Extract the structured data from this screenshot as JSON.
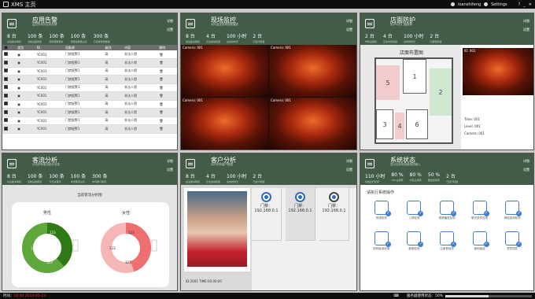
{
  "window": {
    "title": "XMS 主页",
    "user": "loanshifeng",
    "settings": "Settings"
  },
  "common": {
    "detail": "详细",
    "setup": "设置"
  },
  "alarm": {
    "title": "应用告警",
    "sub": "监控所有的应用告警",
    "stats": [
      {
        "v": "8 台",
        "l": "总设备关联机"
      },
      {
        "v": "100 条",
        "l": "当前设备告警"
      },
      {
        "v": "100 条",
        "l": "待处理告警条"
      },
      {
        "v": "100 条",
        "l": "告警总数量占比"
      },
      {
        "v": "300 条",
        "l": "已完成告警数量"
      }
    ],
    "cols": [
      "",
      "类型",
      "ID",
      "设备源",
      "级别",
      "内容",
      "删除"
    ],
    "rows": [
      [
        "YC001",
        "门禁报警1",
        "高",
        "非法人侵"
      ],
      [
        "YC001",
        "门禁报警1",
        "高",
        "非法人侵"
      ],
      [
        "YC001",
        "门禁报警1",
        "高",
        "非法人侵"
      ],
      [
        "YC001",
        "门禁报警1",
        "高",
        "非法人侵"
      ],
      [
        "YC001",
        "门禁报警1",
        "高",
        "非法人侵"
      ],
      [
        "YC001",
        "门禁报警1",
        "高",
        "非法人侵"
      ],
      [
        "YC001",
        "门禁报警1",
        "高",
        "非法人侵"
      ],
      [
        "YC001",
        "门禁报警1",
        "高",
        "非法人侵"
      ],
      [
        "YC001",
        "门禁报警1",
        "高",
        "非法人侵"
      ],
      [
        "YC001",
        "门禁报警1",
        "高",
        "非法人侵"
      ]
    ]
  },
  "monitor": {
    "title": "现场监控",
    "sub": "实时监控现场视频播放",
    "stats": [
      {
        "v": "8 台",
        "l": "总设备关联机"
      },
      {
        "v": "4 台",
        "l": "正在启动机组"
      },
      {
        "v": "100 小时",
        "l": "总启动时长"
      },
      {
        "v": "2 台",
        "l": "已运行机组"
      }
    ],
    "cams": [
      "Camera: 001",
      "Camera: 001",
      "Camera: 001",
      "Camera: 001"
    ]
  },
  "store": {
    "title": "店面防护",
    "sub": "防护中的门窗报警",
    "stats": [
      {
        "v": "2 台",
        "l": "布防设备机"
      },
      {
        "v": "4 台",
        "l": "正在布防机组"
      },
      {
        "v": "100 小时",
        "l": "总布防时长"
      },
      {
        "v": "2 台",
        "l": "已报警机组"
      }
    ],
    "map_title": "店面布置图",
    "rooms": [
      "5",
      "1",
      "2",
      "3",
      "4",
      "6"
    ],
    "cam_id": "ID: 001",
    "info": [
      "Time: 001",
      "Level: 001",
      "Camera: 001"
    ]
  },
  "traffic": {
    "title": "客流分析",
    "sub": "分析所有客流统计信息",
    "stats": [
      {
        "v": "8 台",
        "l": "总设备关联机"
      },
      {
        "v": "100 条",
        "l": "当前设备客流"
      },
      {
        "v": "100 条",
        "l": "今日总客流"
      },
      {
        "v": "100 条",
        "l": "本周客流占比"
      },
      {
        "v": "300 条",
        "l": "本月累计客流"
      }
    ],
    "chart_title": "当前客流分析图",
    "male": "男性",
    "female": "女性",
    "val": "123"
  },
  "customer": {
    "title": "客户分析",
    "sub": "实时识别客户数据",
    "stats": [
      {
        "v": "8 台",
        "l": "总设备关联机"
      },
      {
        "v": "4 台",
        "l": "正在启动机组"
      },
      {
        "v": "100 小时",
        "l": "总启动时长"
      },
      {
        "v": "2 台",
        "l": "已运行机组"
      }
    ],
    "photo_caption": "ID:2001  TIME:00:00:00",
    "doors": [
      "门禁：192.168.0.1",
      "门禁：192.168.0.1",
      "门禁：192.168.0.1"
    ]
  },
  "system": {
    "title": "系统状态",
    "sub": "显示当前系统使用的输入",
    "stats": [
      {
        "v": "110 小时",
        "l": "系统运行时间"
      },
      {
        "v": "80 %",
        "l": "CPU占用率"
      },
      {
        "v": "80 %",
        "l": "内存占用率"
      },
      {
        "v": "50 %",
        "l": "硬盘使用率"
      },
      {
        "v": "2 台",
        "l": "已运行机组"
      }
    ],
    "ops_title": "请执行系统操作",
    "ops": [
      "系统检测",
      "上网检测",
      "视频播放检测",
      "聊天软件检测",
      "网络游戏检测",
      "密码破译检测",
      "数据检测",
      "注册表检测",
      "使用痕迹",
      "恶意插件"
    ]
  },
  "footer": {
    "time_label": "时间：",
    "time": "16:44 2014-05-23",
    "usage_label": "服务器使用状态：",
    "usage": "50%",
    "usage_frac": 0.5
  }
}
